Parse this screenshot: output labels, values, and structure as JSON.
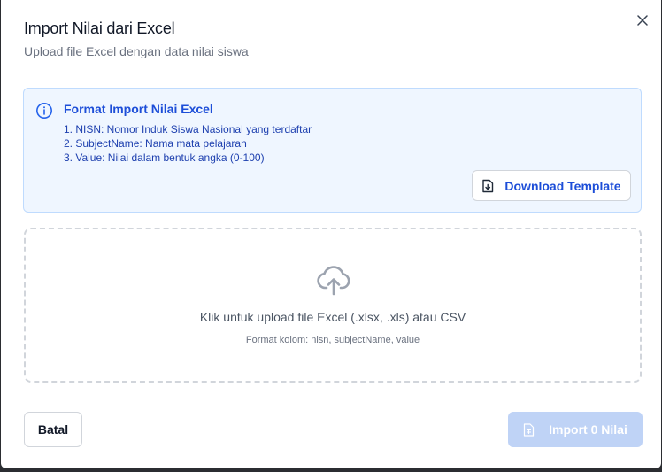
{
  "dialog": {
    "title": "Import Nilai dari Excel",
    "subtitle": "Upload file Excel dengan data nilai siswa",
    "close_icon": "x-icon"
  },
  "info": {
    "icon": "info-circle-icon",
    "title": "Format Import Nilai Excel",
    "items": [
      "1. NISN: Nomor Induk Siswa Nasional yang terdaftar",
      "2. SubjectName: Nama mata pelajaran",
      "3. Value: Nilai dalam bentuk angka (0-100)"
    ],
    "download_label": "Download Template",
    "download_icon": "file-download-icon"
  },
  "dropzone": {
    "icon": "cloud-upload-icon",
    "main_text": "Klik untuk upload file Excel (.xlsx, .xls) atau CSV",
    "sub_text": "Format kolom: nisn, subjectName, value"
  },
  "footer": {
    "cancel_label": "Batal",
    "import_label": "Import 0 Nilai",
    "import_icon": "file-spreadsheet-icon",
    "import_disabled": true
  },
  "colors": {
    "accent": "#1d4ed8",
    "info_bg": "#eff6ff",
    "info_border": "#bfdbfe",
    "import_disabled_bg": "#bfd3f6"
  }
}
